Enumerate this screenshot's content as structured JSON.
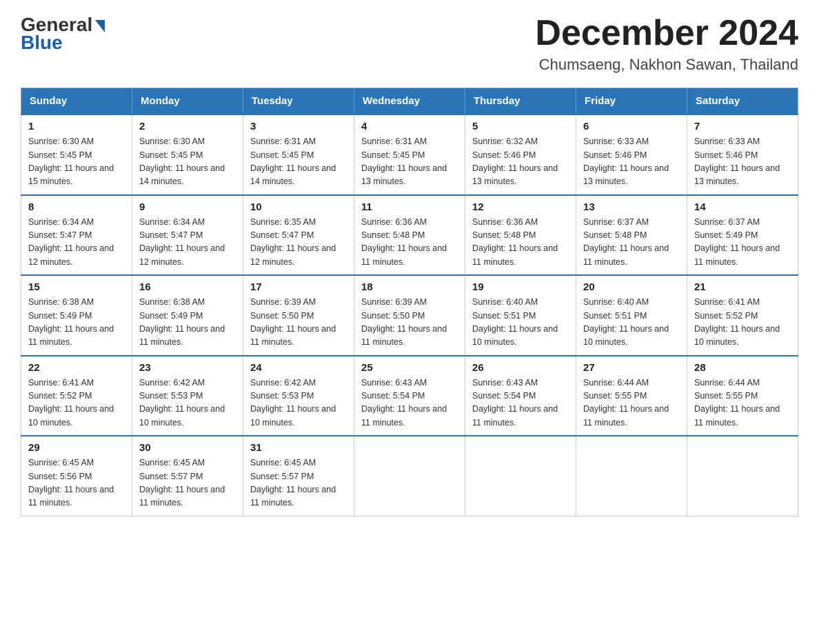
{
  "header": {
    "logo_general": "General",
    "logo_blue": "Blue",
    "month_title": "December 2024",
    "location": "Chumsaeng, Nakhon Sawan, Thailand"
  },
  "days_of_week": [
    "Sunday",
    "Monday",
    "Tuesday",
    "Wednesday",
    "Thursday",
    "Friday",
    "Saturday"
  ],
  "weeks": [
    [
      {
        "day": "1",
        "sunrise": "Sunrise: 6:30 AM",
        "sunset": "Sunset: 5:45 PM",
        "daylight": "Daylight: 11 hours and 15 minutes."
      },
      {
        "day": "2",
        "sunrise": "Sunrise: 6:30 AM",
        "sunset": "Sunset: 5:45 PM",
        "daylight": "Daylight: 11 hours and 14 minutes."
      },
      {
        "day": "3",
        "sunrise": "Sunrise: 6:31 AM",
        "sunset": "Sunset: 5:45 PM",
        "daylight": "Daylight: 11 hours and 14 minutes."
      },
      {
        "day": "4",
        "sunrise": "Sunrise: 6:31 AM",
        "sunset": "Sunset: 5:45 PM",
        "daylight": "Daylight: 11 hours and 13 minutes."
      },
      {
        "day": "5",
        "sunrise": "Sunrise: 6:32 AM",
        "sunset": "Sunset: 5:46 PM",
        "daylight": "Daylight: 11 hours and 13 minutes."
      },
      {
        "day": "6",
        "sunrise": "Sunrise: 6:33 AM",
        "sunset": "Sunset: 5:46 PM",
        "daylight": "Daylight: 11 hours and 13 minutes."
      },
      {
        "day": "7",
        "sunrise": "Sunrise: 6:33 AM",
        "sunset": "Sunset: 5:46 PM",
        "daylight": "Daylight: 11 hours and 13 minutes."
      }
    ],
    [
      {
        "day": "8",
        "sunrise": "Sunrise: 6:34 AM",
        "sunset": "Sunset: 5:47 PM",
        "daylight": "Daylight: 11 hours and 12 minutes."
      },
      {
        "day": "9",
        "sunrise": "Sunrise: 6:34 AM",
        "sunset": "Sunset: 5:47 PM",
        "daylight": "Daylight: 11 hours and 12 minutes."
      },
      {
        "day": "10",
        "sunrise": "Sunrise: 6:35 AM",
        "sunset": "Sunset: 5:47 PM",
        "daylight": "Daylight: 11 hours and 12 minutes."
      },
      {
        "day": "11",
        "sunrise": "Sunrise: 6:36 AM",
        "sunset": "Sunset: 5:48 PM",
        "daylight": "Daylight: 11 hours and 11 minutes."
      },
      {
        "day": "12",
        "sunrise": "Sunrise: 6:36 AM",
        "sunset": "Sunset: 5:48 PM",
        "daylight": "Daylight: 11 hours and 11 minutes."
      },
      {
        "day": "13",
        "sunrise": "Sunrise: 6:37 AM",
        "sunset": "Sunset: 5:48 PM",
        "daylight": "Daylight: 11 hours and 11 minutes."
      },
      {
        "day": "14",
        "sunrise": "Sunrise: 6:37 AM",
        "sunset": "Sunset: 5:49 PM",
        "daylight": "Daylight: 11 hours and 11 minutes."
      }
    ],
    [
      {
        "day": "15",
        "sunrise": "Sunrise: 6:38 AM",
        "sunset": "Sunset: 5:49 PM",
        "daylight": "Daylight: 11 hours and 11 minutes."
      },
      {
        "day": "16",
        "sunrise": "Sunrise: 6:38 AM",
        "sunset": "Sunset: 5:49 PM",
        "daylight": "Daylight: 11 hours and 11 minutes."
      },
      {
        "day": "17",
        "sunrise": "Sunrise: 6:39 AM",
        "sunset": "Sunset: 5:50 PM",
        "daylight": "Daylight: 11 hours and 11 minutes."
      },
      {
        "day": "18",
        "sunrise": "Sunrise: 6:39 AM",
        "sunset": "Sunset: 5:50 PM",
        "daylight": "Daylight: 11 hours and 11 minutes."
      },
      {
        "day": "19",
        "sunrise": "Sunrise: 6:40 AM",
        "sunset": "Sunset: 5:51 PM",
        "daylight": "Daylight: 11 hours and 10 minutes."
      },
      {
        "day": "20",
        "sunrise": "Sunrise: 6:40 AM",
        "sunset": "Sunset: 5:51 PM",
        "daylight": "Daylight: 11 hours and 10 minutes."
      },
      {
        "day": "21",
        "sunrise": "Sunrise: 6:41 AM",
        "sunset": "Sunset: 5:52 PM",
        "daylight": "Daylight: 11 hours and 10 minutes."
      }
    ],
    [
      {
        "day": "22",
        "sunrise": "Sunrise: 6:41 AM",
        "sunset": "Sunset: 5:52 PM",
        "daylight": "Daylight: 11 hours and 10 minutes."
      },
      {
        "day": "23",
        "sunrise": "Sunrise: 6:42 AM",
        "sunset": "Sunset: 5:53 PM",
        "daylight": "Daylight: 11 hours and 10 minutes."
      },
      {
        "day": "24",
        "sunrise": "Sunrise: 6:42 AM",
        "sunset": "Sunset: 5:53 PM",
        "daylight": "Daylight: 11 hours and 10 minutes."
      },
      {
        "day": "25",
        "sunrise": "Sunrise: 6:43 AM",
        "sunset": "Sunset: 5:54 PM",
        "daylight": "Daylight: 11 hours and 11 minutes."
      },
      {
        "day": "26",
        "sunrise": "Sunrise: 6:43 AM",
        "sunset": "Sunset: 5:54 PM",
        "daylight": "Daylight: 11 hours and 11 minutes."
      },
      {
        "day": "27",
        "sunrise": "Sunrise: 6:44 AM",
        "sunset": "Sunset: 5:55 PM",
        "daylight": "Daylight: 11 hours and 11 minutes."
      },
      {
        "day": "28",
        "sunrise": "Sunrise: 6:44 AM",
        "sunset": "Sunset: 5:55 PM",
        "daylight": "Daylight: 11 hours and 11 minutes."
      }
    ],
    [
      {
        "day": "29",
        "sunrise": "Sunrise: 6:45 AM",
        "sunset": "Sunset: 5:56 PM",
        "daylight": "Daylight: 11 hours and 11 minutes."
      },
      {
        "day": "30",
        "sunrise": "Sunrise: 6:45 AM",
        "sunset": "Sunset: 5:57 PM",
        "daylight": "Daylight: 11 hours and 11 minutes."
      },
      {
        "day": "31",
        "sunrise": "Sunrise: 6:45 AM",
        "sunset": "Sunset: 5:57 PM",
        "daylight": "Daylight: 11 hours and 11 minutes."
      },
      null,
      null,
      null,
      null
    ]
  ]
}
